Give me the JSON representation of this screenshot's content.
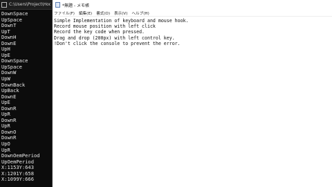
{
  "console": {
    "title": "C:\\Users\\Project\\Hook\\",
    "lines": [
      "DownSpace",
      "UpSpace",
      "DownT",
      "UpT",
      "DownH",
      "DownE",
      "UpH",
      "UpE",
      "DownSpace",
      "UpSpace",
      "DownW",
      "UpW",
      "DownBack",
      "UpBack",
      "DownE",
      "UpE",
      "DownR",
      "UpR",
      "DownR",
      "UpR",
      "DownO",
      "DownR",
      "UpO",
      "UpR",
      "DownOemPeriod",
      "UpOemPeriod",
      "X:1153Y:643",
      "X:1201Y:658",
      "X:1099Y:666"
    ]
  },
  "notepad": {
    "title": "*無題 - メモ帳",
    "menu": [
      "ファイル(F)",
      "編集(E)",
      "書式(O)",
      "表示(V)",
      "ヘルプ(H)"
    ],
    "lines": [
      "Simple Implementation of keyboard and mouse hook.",
      "Record mouse position with left click",
      "Record the key code when pressed.",
      "Drag and drop (200px) with left control key.",
      "!Don't click the console to prevent the error."
    ]
  }
}
